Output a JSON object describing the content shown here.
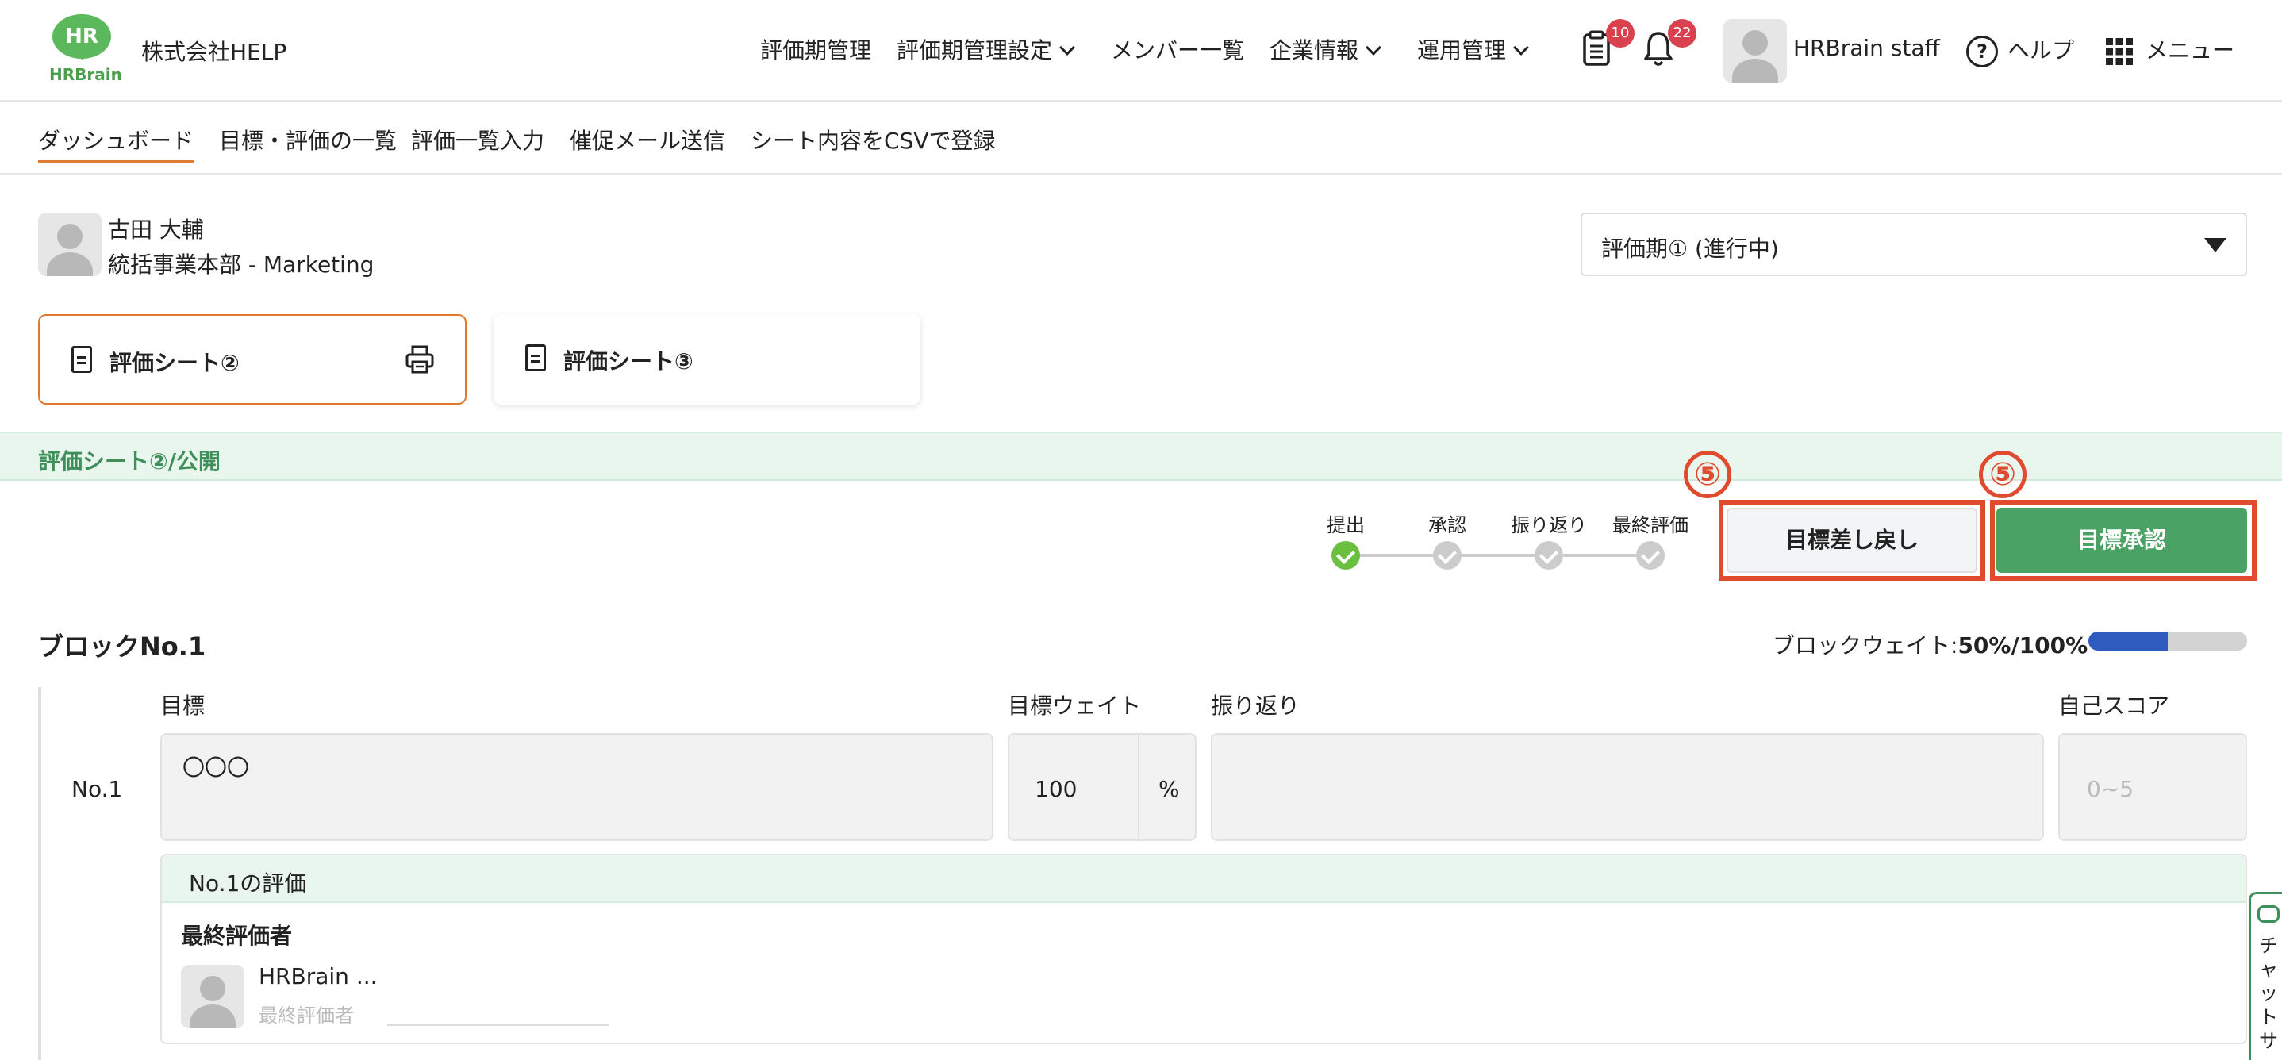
{
  "header": {
    "logo_text": "HR",
    "logo_word": "HRBrain",
    "company": "株式会社HELP",
    "nav": [
      {
        "label": "評価期管理",
        "dropdown": false
      },
      {
        "label": "評価期管理設定",
        "dropdown": true
      },
      {
        "label": "メンバー一覧",
        "dropdown": false
      },
      {
        "label": "企業情報",
        "dropdown": true
      },
      {
        "label": "運用管理",
        "dropdown": true
      }
    ],
    "tasks_badge": "10",
    "notifications_badge": "22",
    "user_name": "HRBrain staff",
    "help_label": "ヘルプ",
    "menu_label": "メニュー"
  },
  "subnav": {
    "tabs": [
      "ダッシュボード",
      "目標・評価の一覧",
      "評価一覧入力",
      "催促メール送信",
      "シート内容をCSVで登録"
    ]
  },
  "member": {
    "name": "古田 大輔",
    "department": "統括事業本部 - Marketing"
  },
  "period_select": {
    "value": "評価期① (進行中)"
  },
  "sheets": [
    {
      "label": "評価シート②",
      "active": true
    },
    {
      "label": "評価シート③",
      "active": false
    }
  ],
  "section_title": "評価シート②/公開",
  "steps": [
    {
      "label": "提出",
      "done": true
    },
    {
      "label": "承認",
      "done": false
    },
    {
      "label": "振り返り",
      "done": false
    },
    {
      "label": "最終評価",
      "done": false
    }
  ],
  "annotation_marker": "⑤",
  "actions": {
    "return_label": "目標差し戻し",
    "approve_label": "目標承認"
  },
  "block": {
    "title": "ブロックNo.1",
    "weight_label": "ブロックウェイト:",
    "weight_value": "50%/100%",
    "weight_fraction": 0.5,
    "col_goal": "目標",
    "col_weight": "目標ウェイト",
    "col_review": "振り返り",
    "col_score": "自己スコア",
    "row_number": "No.1",
    "goal_text": "〇〇〇",
    "weight": "100",
    "weight_unit": "%",
    "score_placeholder": "0~5",
    "eval_title": "No.1の評価",
    "evaluator_title": "最終評価者",
    "evaluator_name": "HRBrain ...",
    "evaluator_role": "最終評価者"
  },
  "chat_label": "チャットサ",
  "colors": {
    "brand_green": "#5cb85c",
    "approve_green": "#4aa364",
    "accent_orange": "#e07a2e",
    "annotation_red": "#e04a2e",
    "badge_red": "#d9414f",
    "weight_blue": "#2f5bbf"
  }
}
